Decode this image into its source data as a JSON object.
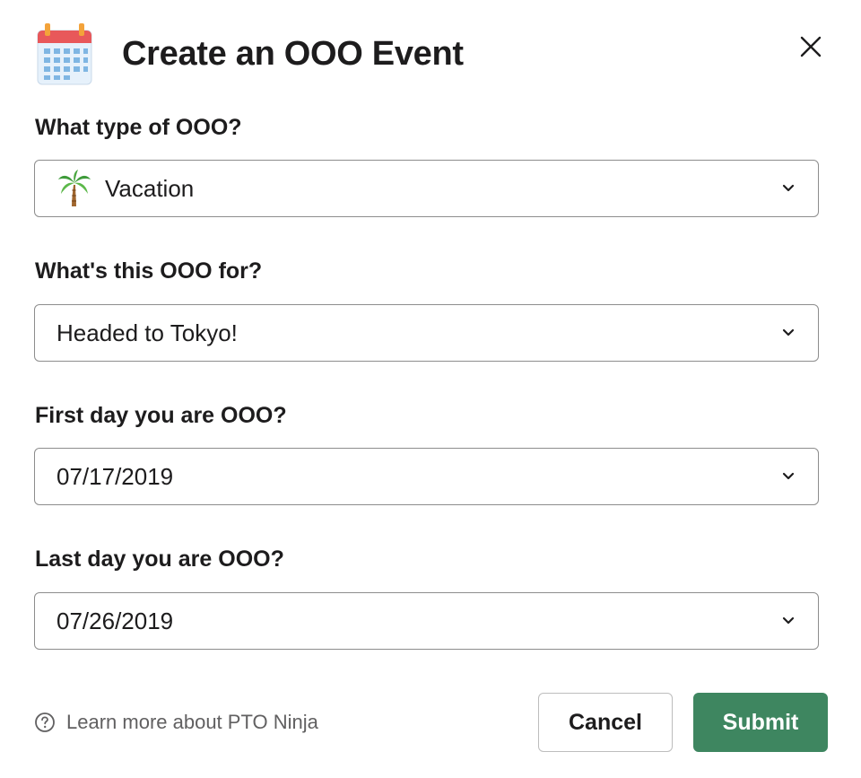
{
  "modal": {
    "title": "Create an OOO Event",
    "icon": "calendar-icon",
    "close_icon": "close-icon"
  },
  "fields": [
    {
      "label": "What type of OOO?",
      "value": "Vacation",
      "emoji": "palm-tree-icon"
    },
    {
      "label": "What's this OOO for?",
      "value": "Headed to Tokyo!"
    },
    {
      "label": "First day you are OOO?",
      "value": "07/17/2019"
    },
    {
      "label": "Last day you are OOO?",
      "value": "07/26/2019"
    }
  ],
  "footer": {
    "help_text": "Learn more about PTO Ninja",
    "help_icon": "question-circle-icon",
    "cancel_label": "Cancel",
    "submit_label": "Submit"
  },
  "colors": {
    "submit": "#3e8660",
    "border": "#8d8d8d",
    "text": "#1d1c1d",
    "muted": "#616061"
  }
}
